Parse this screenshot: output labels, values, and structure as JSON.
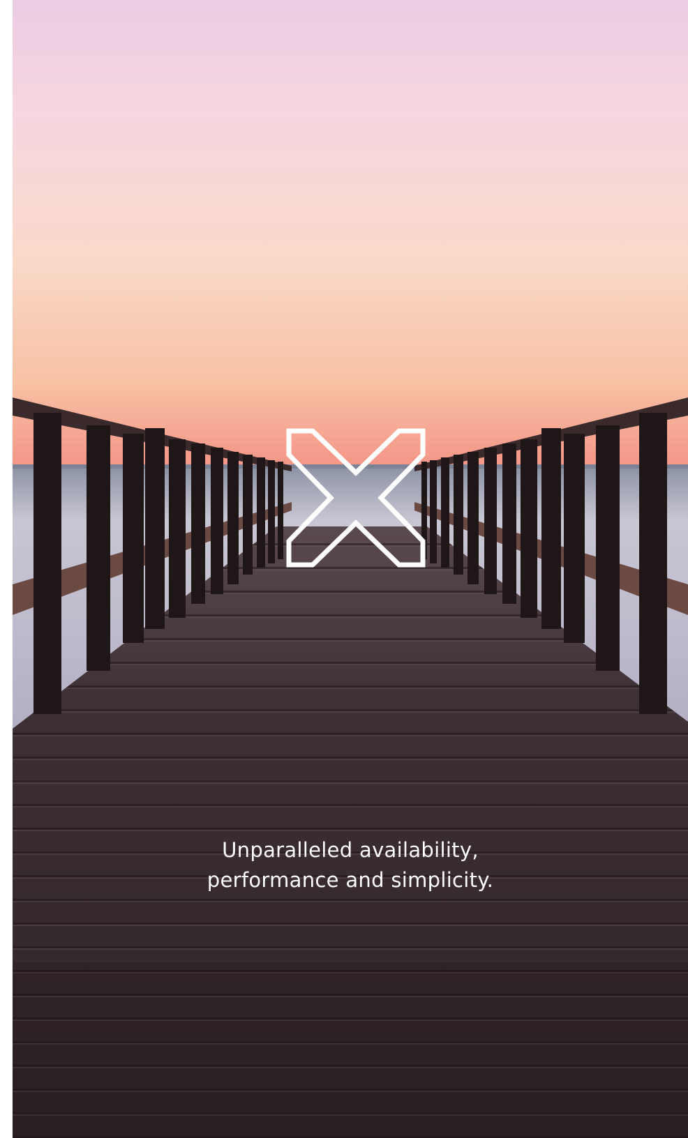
{
  "hero": {
    "logo_icon": "brand-x-outline-icon",
    "tagline": {
      "line1": "Unparalleled availability,",
      "line2": "performance and simplicity."
    }
  },
  "colors": {
    "sky_top": "#eecfe0",
    "sky_mid": "#f8dcd2",
    "sky_bottom": "#f7b89c",
    "horizon_glow": "#f39a8e",
    "sea": "#b9b6c9",
    "deck": "#3f3238",
    "deck_dark": "#2a2024",
    "text": "#ffffff"
  }
}
